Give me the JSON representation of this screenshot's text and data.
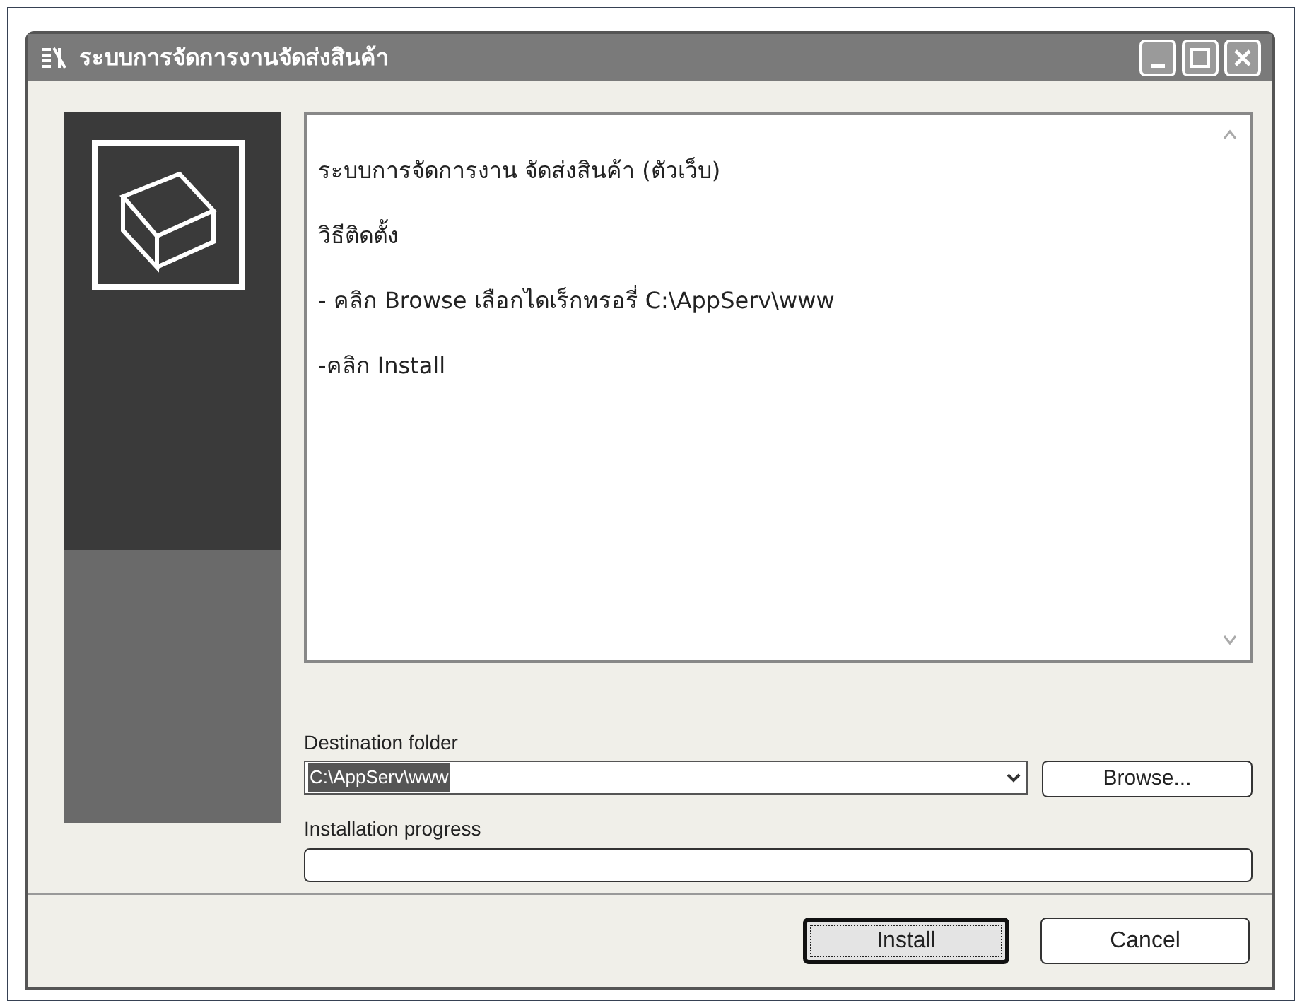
{
  "window": {
    "title": "ระบบการจัดการงานจัดส่งสินค้า"
  },
  "readme": [
    "ระบบการจัดการงาน จัดส่งสินค้า (ตัวเว็บ)",
    "วิธีติดตั้ง",
    "- คลิก Browse เลือกไดเร็กทรอรี่ C:\\AppServ\\www",
    "-คลิก Install"
  ],
  "destination": {
    "label": "Destination folder",
    "value": "C:\\AppServ\\www",
    "browse": "Browse..."
  },
  "progress": {
    "label": "Installation progress",
    "level": 0
  },
  "buttons": [
    {
      "label": "Install",
      "focused": true
    },
    {
      "label": "Cancel",
      "focused": false
    }
  ]
}
